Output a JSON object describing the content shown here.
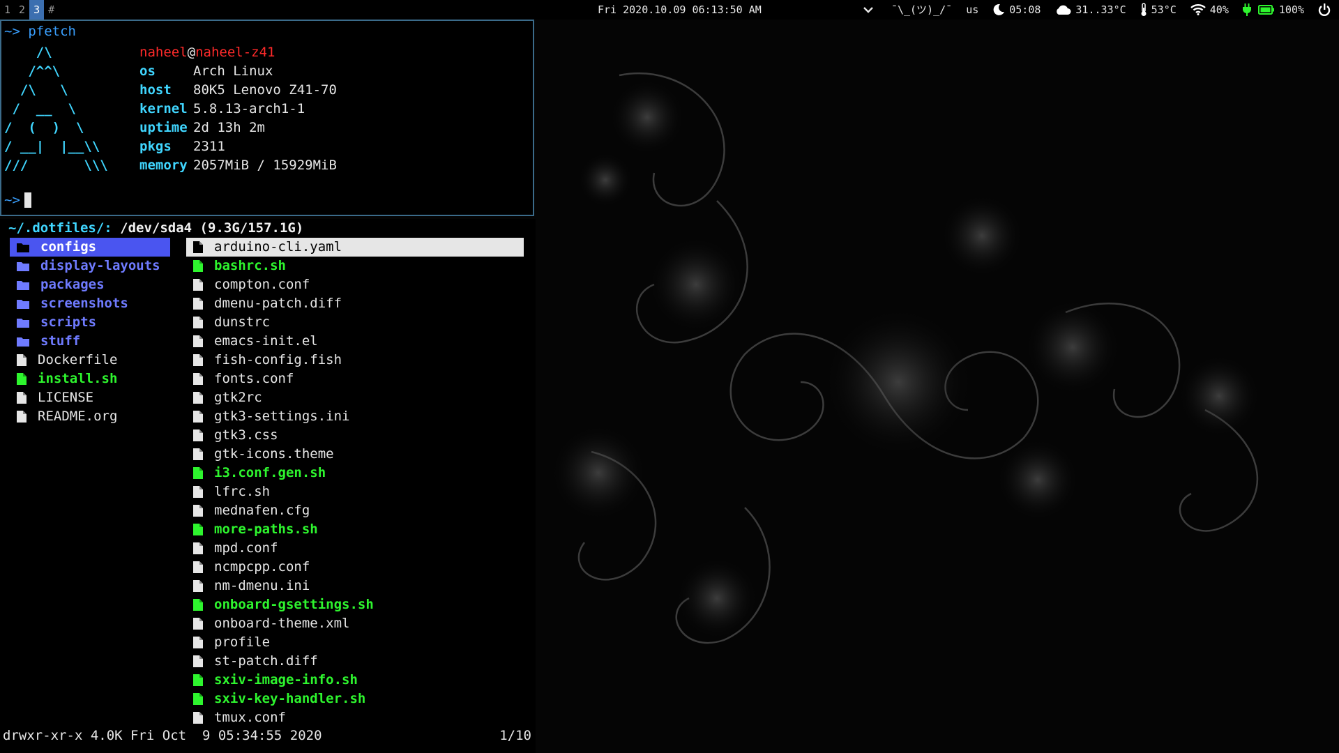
{
  "bar": {
    "workspaces": [
      {
        "label": "1",
        "active": false
      },
      {
        "label": "2",
        "active": false
      },
      {
        "label": "3",
        "active": true
      },
      {
        "label": "#",
        "active": false
      }
    ],
    "clock": "Fri 2020.10.09 06:13:50 AM",
    "status": {
      "shrug": "¯\\_(ツ)_/¯",
      "layout": "us",
      "night_time": "05:08",
      "weather": "31..33°C",
      "temp": "53°C",
      "wifi": "40%",
      "battery": "100%"
    }
  },
  "term1": {
    "prompt": "~>",
    "command": "pfetch",
    "ascii": "    /\\\n   /^^\\\n  /\\   \\\n /  __  \\\n/  (  )  \\\n/ __|  |__\\\\\n///       \\\\\\",
    "user": "naheel",
    "host": "naheel-z41",
    "info": [
      {
        "key": "os",
        "value": "Arch Linux"
      },
      {
        "key": "host",
        "value": "80K5 Lenovo Z41-70"
      },
      {
        "key": "kernel",
        "value": "5.8.13-arch1-1"
      },
      {
        "key": "uptime",
        "value": "2d 13h 2m"
      },
      {
        "key": "pkgs",
        "value": "2311"
      },
      {
        "key": "memory",
        "value": "2057MiB / 15929MiB"
      }
    ]
  },
  "lf": {
    "path": "~/.dotfiles/:",
    "device": "/dev/sda4 (9.3G/157.1G)",
    "left": [
      {
        "name": "configs",
        "type": "dir",
        "selected": true
      },
      {
        "name": "display-layouts",
        "type": "dir"
      },
      {
        "name": "packages",
        "type": "dir"
      },
      {
        "name": "screenshots",
        "type": "dir"
      },
      {
        "name": "scripts",
        "type": "dir"
      },
      {
        "name": "stuff",
        "type": "dir"
      },
      {
        "name": "Dockerfile",
        "type": "file"
      },
      {
        "name": "install.sh",
        "type": "exe"
      },
      {
        "name": "LICENSE",
        "type": "file"
      },
      {
        "name": "README.org",
        "type": "file"
      }
    ],
    "right": [
      {
        "name": "arduino-cli.yaml",
        "type": "file",
        "selected": true
      },
      {
        "name": "bashrc.sh",
        "type": "exe"
      },
      {
        "name": "compton.conf",
        "type": "file"
      },
      {
        "name": "dmenu-patch.diff",
        "type": "file"
      },
      {
        "name": "dunstrc",
        "type": "file"
      },
      {
        "name": "emacs-init.el",
        "type": "file"
      },
      {
        "name": "fish-config.fish",
        "type": "file"
      },
      {
        "name": "fonts.conf",
        "type": "file"
      },
      {
        "name": "gtk2rc",
        "type": "file"
      },
      {
        "name": "gtk3-settings.ini",
        "type": "file"
      },
      {
        "name": "gtk3.css",
        "type": "file"
      },
      {
        "name": "gtk-icons.theme",
        "type": "file"
      },
      {
        "name": "i3.conf.gen.sh",
        "type": "exe"
      },
      {
        "name": "lfrc.sh",
        "type": "file"
      },
      {
        "name": "mednafen.cfg",
        "type": "file"
      },
      {
        "name": "more-paths.sh",
        "type": "exe"
      },
      {
        "name": "mpd.conf",
        "type": "file"
      },
      {
        "name": "ncmpcpp.conf",
        "type": "file"
      },
      {
        "name": "nm-dmenu.ini",
        "type": "file"
      },
      {
        "name": "onboard-gsettings.sh",
        "type": "exe"
      },
      {
        "name": "onboard-theme.xml",
        "type": "file"
      },
      {
        "name": "profile",
        "type": "file"
      },
      {
        "name": "st-patch.diff",
        "type": "file"
      },
      {
        "name": "sxiv-image-info.sh",
        "type": "exe"
      },
      {
        "name": "sxiv-key-handler.sh",
        "type": "exe"
      },
      {
        "name": "tmux.conf",
        "type": "file"
      }
    ],
    "status_line": "drwxr-xr-x 4.0K Fri Oct  9 05:34:55 2020",
    "count": "1/10"
  }
}
